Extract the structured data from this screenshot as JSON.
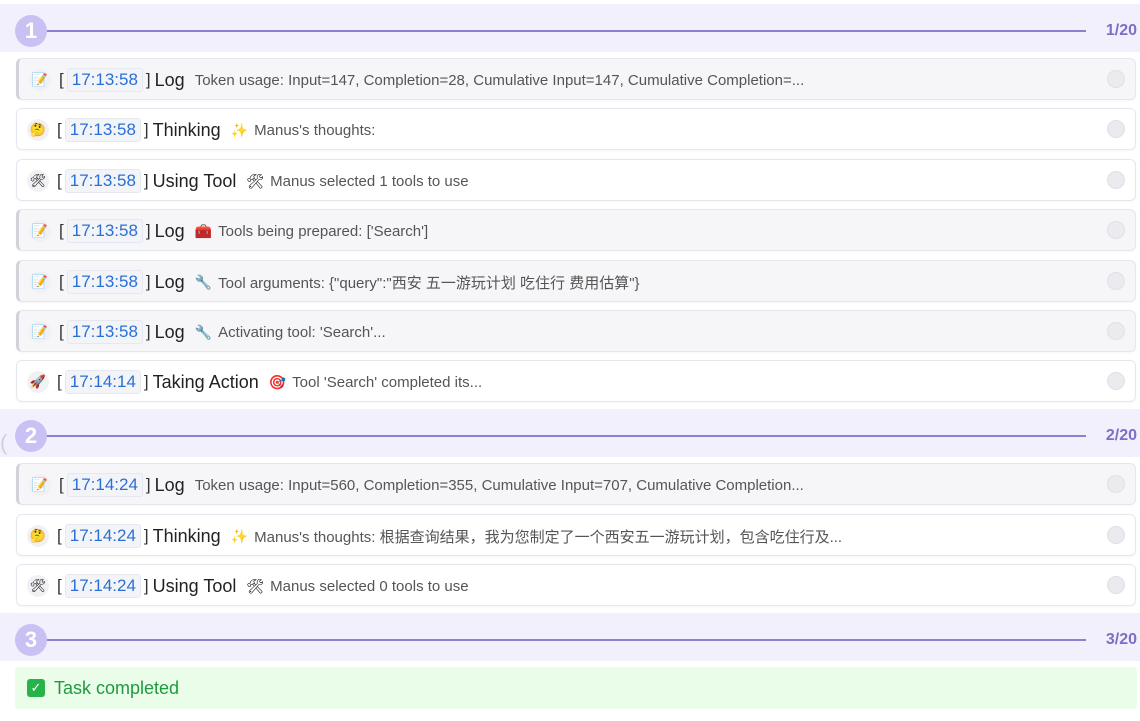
{
  "steps": [
    {
      "number": "1",
      "count": "1/20",
      "entries": [
        {
          "kind": "log",
          "icon": "📝",
          "time": "17:13:58",
          "type": "Log",
          "msg_icon": "",
          "msg": "Token usage: Input=147, Completion=28, Cumulative Input=147, Cumulative Completion=..."
        },
        {
          "kind": "thinking",
          "icon": "🤔",
          "time": "17:13:58",
          "type": "Thinking",
          "msg_icon": "✨",
          "msg": "Manus's thoughts:"
        },
        {
          "kind": "tool",
          "icon": "🛠",
          "time": "17:13:58",
          "type": "Using Tool",
          "msg_icon": "🛠",
          "msg": "Manus selected 1 tools to use"
        },
        {
          "kind": "log",
          "icon": "📝",
          "time": "17:13:58",
          "type": "Log",
          "msg_icon": "🧰",
          "msg": "Tools being prepared: ['Search']"
        },
        {
          "kind": "log",
          "icon": "📝",
          "time": "17:13:58",
          "type": "Log",
          "msg_icon": "🔧",
          "msg": "Tool arguments: {\"query\":\"西安 五一游玩计划 吃住行 费用估算\"}"
        },
        {
          "kind": "log",
          "icon": "📝",
          "time": "17:13:58",
          "type": "Log",
          "msg_icon": "🔧",
          "msg": "Activating tool: 'Search'..."
        },
        {
          "kind": "action",
          "icon": "🚀",
          "time": "17:14:14",
          "type": "Taking Action",
          "msg_icon": "🎯",
          "msg": "Tool 'Search' completed its..."
        }
      ]
    },
    {
      "number": "2",
      "count": "2/20",
      "entries": [
        {
          "kind": "log",
          "icon": "📝",
          "time": "17:14:24",
          "type": "Log",
          "msg_icon": "",
          "msg": "Token usage: Input=560, Completion=355, Cumulative Input=707, Cumulative Completion..."
        },
        {
          "kind": "thinking",
          "icon": "🤔",
          "time": "17:14:24",
          "type": "Thinking",
          "msg_icon": "✨",
          "msg": "Manus's thoughts: 根据查询结果，我为您制定了一个西安五一游玩计划，包含吃住行及..."
        },
        {
          "kind": "tool",
          "icon": "🛠",
          "time": "17:14:24",
          "type": "Using Tool",
          "msg_icon": "🛠",
          "msg": "Manus selected 0 tools to use"
        }
      ]
    },
    {
      "number": "3",
      "count": "3/20",
      "entries": []
    }
  ],
  "completed": {
    "icon": "✓",
    "label": "Task completed"
  },
  "colors": {
    "accent": "#8a82d0",
    "time": "#2a6fd6",
    "success": "#27b34a"
  }
}
